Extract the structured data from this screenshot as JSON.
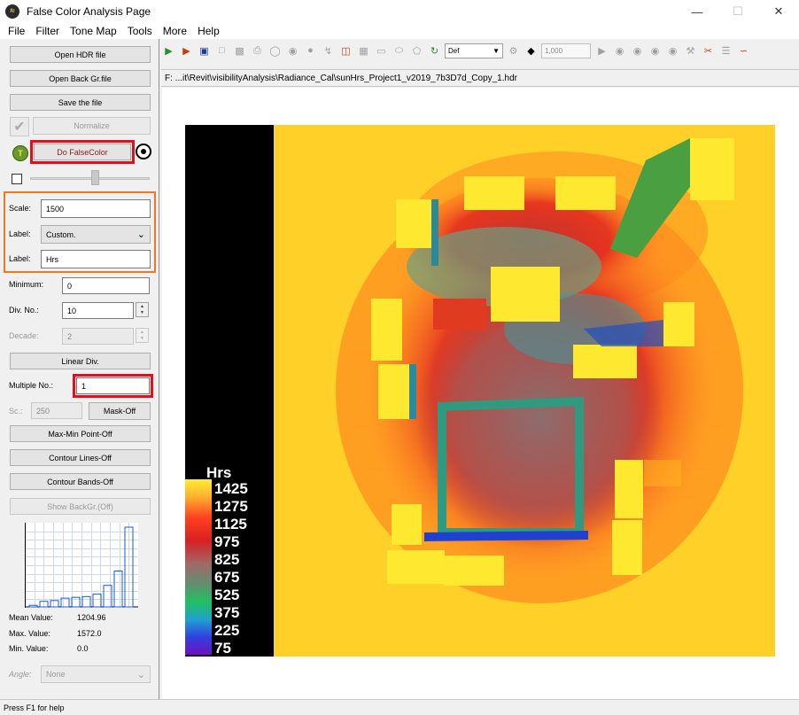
{
  "window": {
    "title": "False Color Analysis Page",
    "icon_text": "falsecolor"
  },
  "menu": {
    "items": [
      "File",
      "Filter",
      "Tone Map",
      "Tools",
      "More",
      "Help"
    ]
  },
  "toolbar": {
    "select_value": "Def",
    "input_value": "1,000"
  },
  "path": {
    "text": "F: ...it\\Revit\\visibilityAnalysis\\Radiance_Cal\\sunHrs_Project1_v2019_7b3D7d_Copy_1.hdr"
  },
  "panel": {
    "open_hdr": "Open HDR file",
    "open_back": "Open Back Gr.file",
    "save": "Save the file",
    "normalize": "Normalize",
    "do_falsecolor": "Do FalseColor",
    "scale_label": "Scale:",
    "scale_value": "1500",
    "label_label": "Label:",
    "label_select": "Custom.",
    "label2_label": "Label:",
    "label2_value": "Hrs",
    "minimum_label": "Minimum:",
    "minimum_value": "0",
    "divno_label": "Div. No.:",
    "divno_value": "10",
    "decade_label": "Decade:",
    "decade_value": "2",
    "linear_div": "Linear Div.",
    "multiple_label": "Multiple No.:",
    "multiple_value": "1",
    "sc_label": "Sc.:",
    "sc_value": "250",
    "mask": "Mask-Off",
    "maxmin": "Max-Min Point-Off",
    "contour_lines": "Contour Lines-Off",
    "contour_bands": "Contour Bands-Off",
    "show_backgr": "Show BackGr.(Off)",
    "mean_label": "Mean Value:",
    "mean_value": "1204.96",
    "max_label": "Max. Value:",
    "max_value": "1572.0",
    "min_label": "Min. Value:",
    "min_value": "0.0",
    "angle_label": "Angle:",
    "angle_value": "None"
  },
  "histogram": {
    "bars": [
      0.02,
      0.07,
      0.08,
      0.11,
      0.12,
      0.13,
      0.16,
      0.27,
      0.45,
      1.0
    ]
  },
  "legend": {
    "title": "Hrs",
    "values": [
      "1425",
      "1275",
      "1125",
      "975",
      "825",
      "675",
      "525",
      "375",
      "225",
      "75"
    ]
  },
  "status": {
    "text": "Press F1 for help"
  },
  "colors": {
    "red_highlight": "#e0101e",
    "orange_highlight": "#f07820"
  }
}
